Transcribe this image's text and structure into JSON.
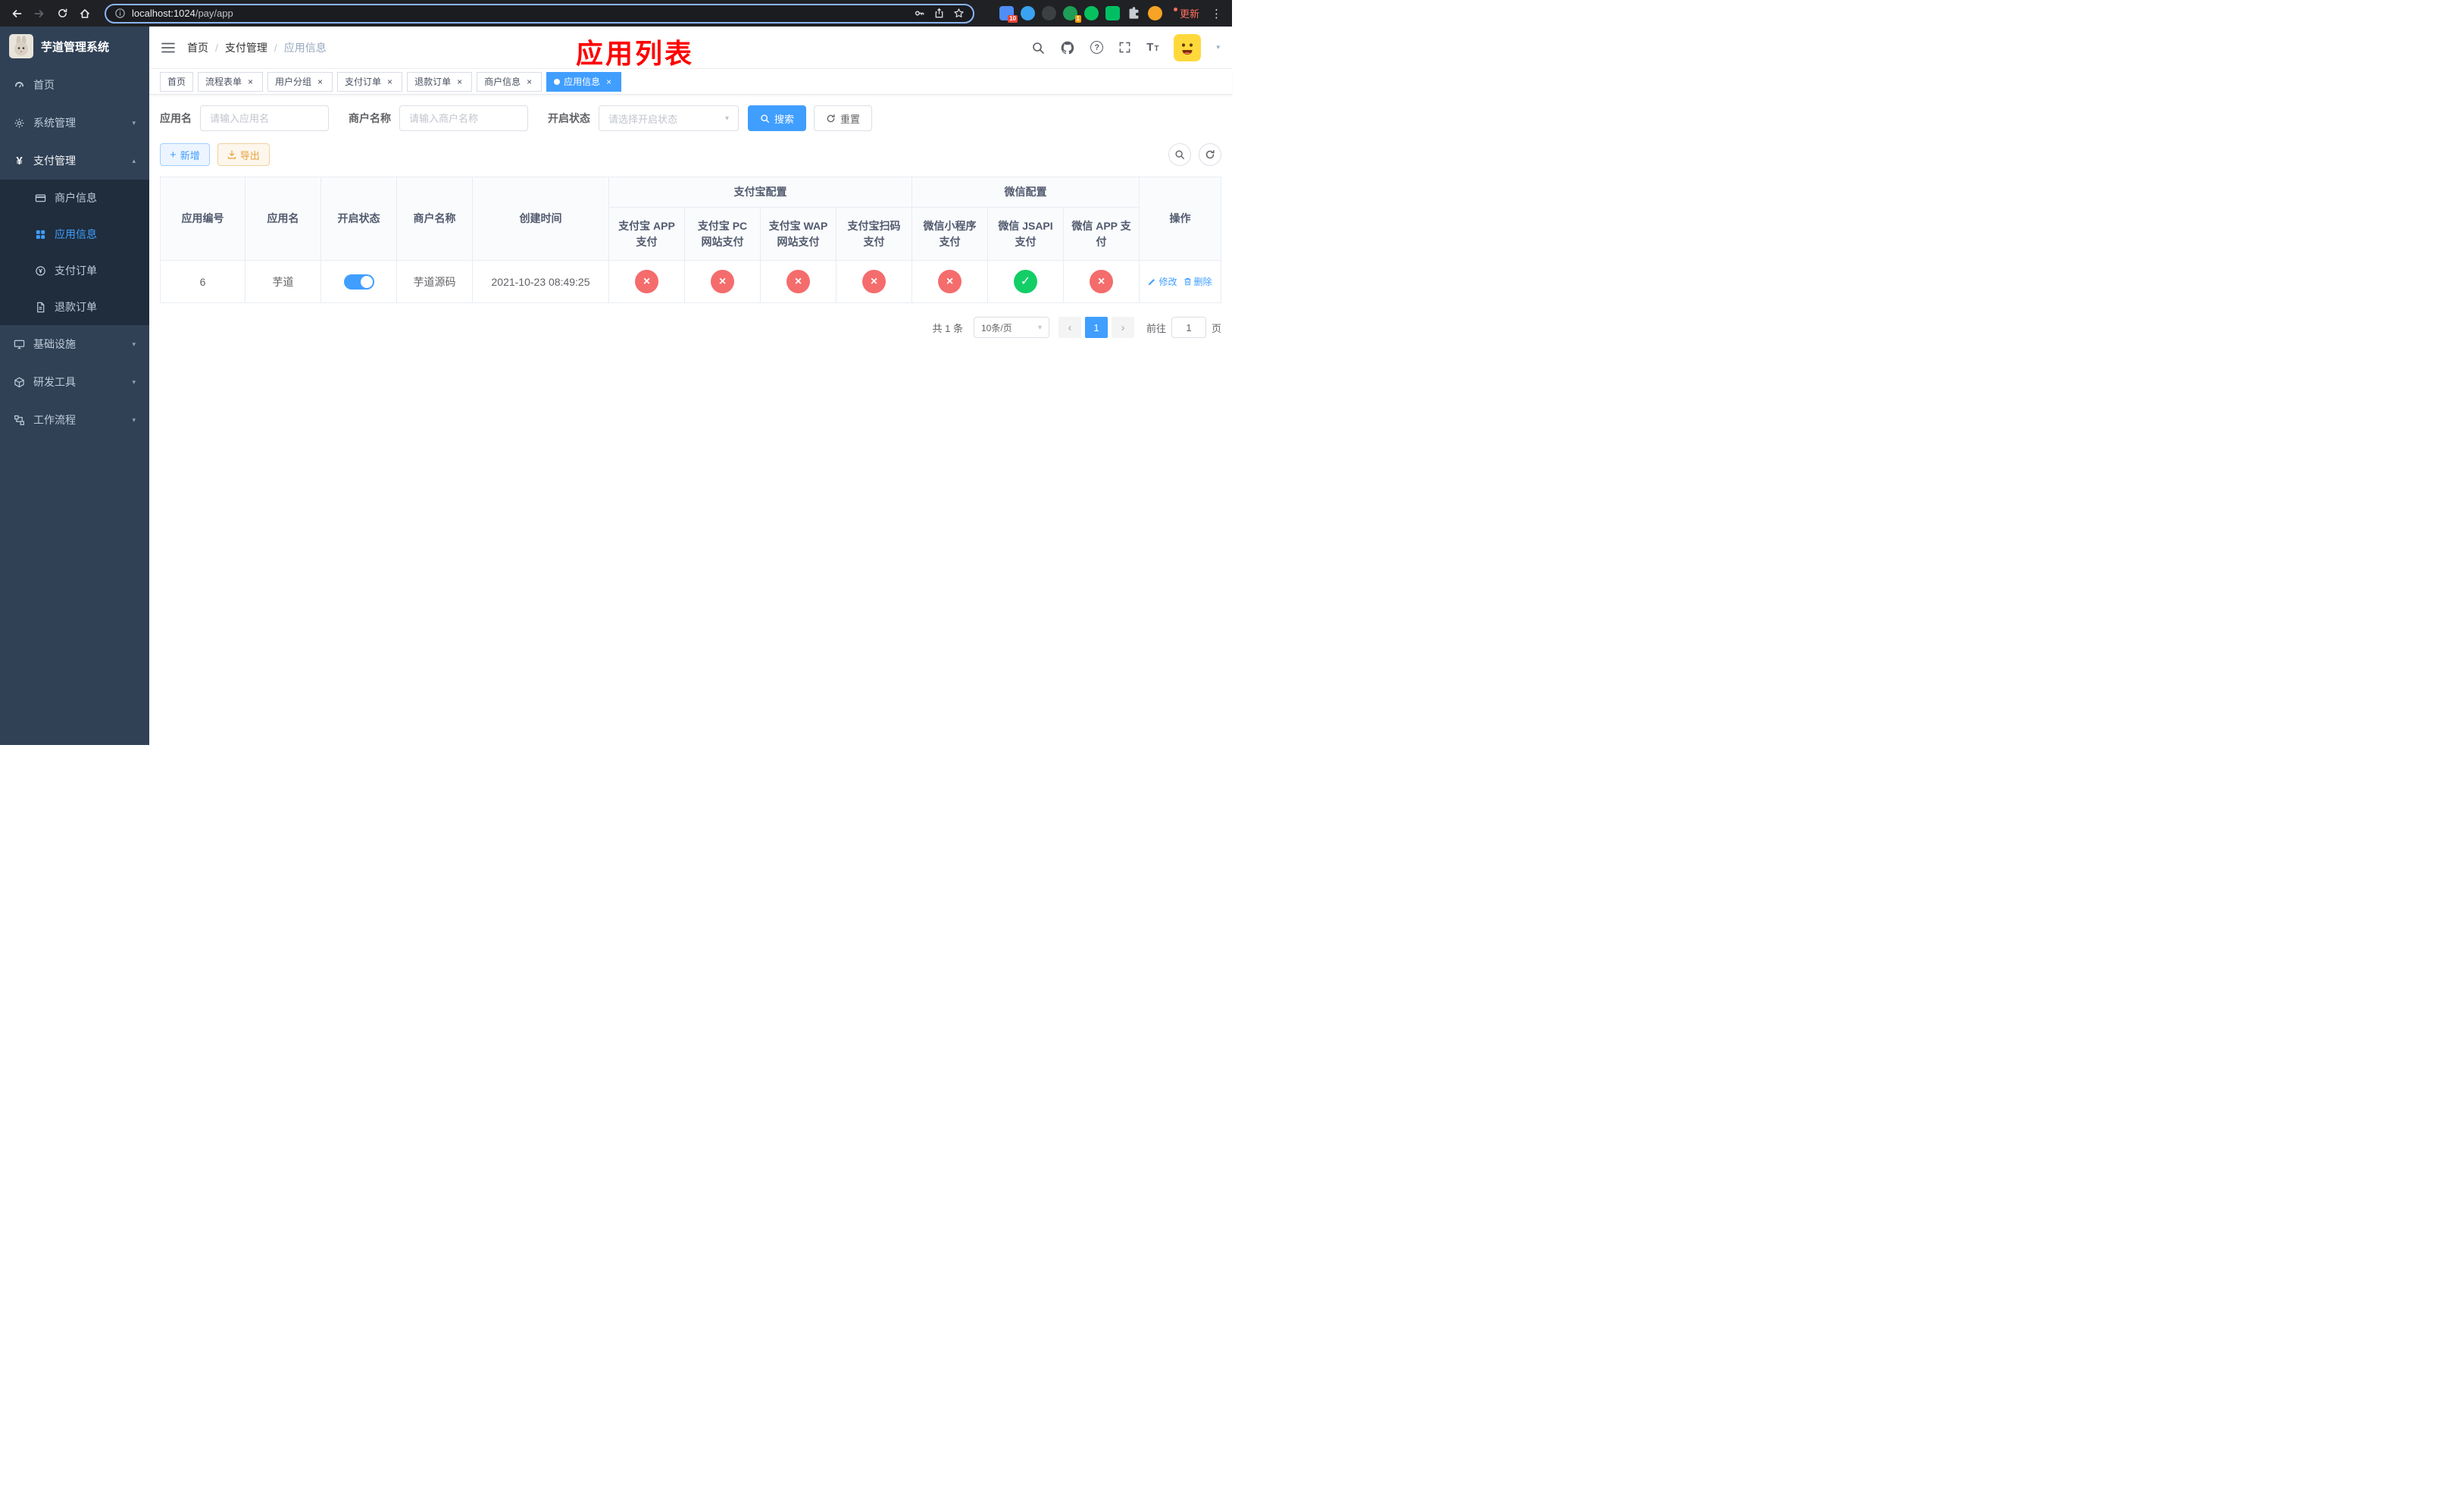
{
  "colors": {
    "primary": "#409eff",
    "danger": "#f56c6c",
    "success": "#13ce66",
    "sidebar_bg": "#304156",
    "submenu_bg": "#1f2d3d",
    "annotation": "#fe0000"
  },
  "icons": {
    "close": "×",
    "check": "✓",
    "cross": "×",
    "plus": "+",
    "caret_down": "▾",
    "caret_up": "▴",
    "chevron_left": "‹",
    "chevron_right": "›",
    "kebab": "⋮",
    "help": "?",
    "font": "T"
  },
  "browser": {
    "url_host": "localhost:1024",
    "url_path": "/pay/app",
    "update_label": "更新",
    "ext_badge_a": "10",
    "ext_badge_b": "1"
  },
  "sidebar": {
    "title": "芋道管理系统",
    "items": [
      {
        "label": "首页"
      },
      {
        "label": "系统管理"
      },
      {
        "label": "支付管理"
      },
      {
        "label": "基础设施"
      },
      {
        "label": "研发工具"
      },
      {
        "label": "工作流程"
      }
    ],
    "submenu": [
      {
        "label": "商户信息"
      },
      {
        "label": "应用信息"
      },
      {
        "label": "支付订单"
      },
      {
        "label": "退款订单"
      }
    ]
  },
  "header": {
    "breadcrumb": [
      "首页",
      "支付管理",
      "应用信息"
    ],
    "annotation": "应用列表"
  },
  "tabs": [
    {
      "label": "首页"
    },
    {
      "label": "流程表单"
    },
    {
      "label": "用户分组"
    },
    {
      "label": "支付订单"
    },
    {
      "label": "退款订单"
    },
    {
      "label": "商户信息"
    },
    {
      "label": "应用信息"
    }
  ],
  "filters": {
    "app_name_label": "应用名",
    "app_name_placeholder": "请输入应用名",
    "merchant_label": "商户名称",
    "merchant_placeholder": "请输入商户名称",
    "status_label": "开启状态",
    "status_placeholder": "请选择开启状态",
    "search_label": "搜索",
    "reset_label": "重置"
  },
  "toolbar": {
    "add_label": "新增",
    "export_label": "导出"
  },
  "table": {
    "col_id": "应用编号",
    "col_name": "应用名",
    "col_status": "开启状态",
    "col_merchant": "商户名称",
    "col_created": "创建时间",
    "col_actions": "操作",
    "group_alipay": "支付宝配置",
    "group_wechat": "微信配置",
    "sub_cols": [
      "支付宝 APP 支付",
      "支付宝 PC 网站支付",
      "支付宝 WAP 网站支付",
      "支付宝扫码支付",
      "微信小程序支付",
      "微信 JSAPI 支付",
      "微信 APP 支付"
    ],
    "row": {
      "id": "6",
      "name": "芋道",
      "enabled": true,
      "merchant": "芋道源码",
      "created": "2021-10-23 08:49:25",
      "configs": [
        "no",
        "no",
        "no",
        "no",
        "no",
        "yes",
        "no"
      ],
      "edit_label": "修改",
      "delete_label": "删除"
    }
  },
  "pagination": {
    "total": "共 1 条",
    "page_size": "10条/页",
    "current": "1",
    "goto_label": "前往",
    "goto_value": "1",
    "page_suffix": "页"
  }
}
